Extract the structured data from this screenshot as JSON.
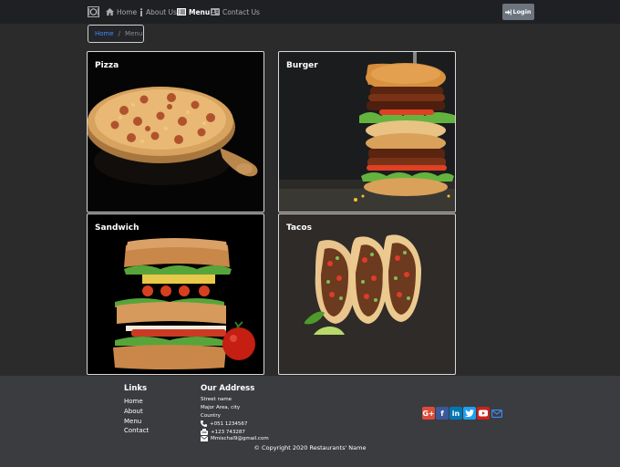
{
  "nav": {
    "home": "Home",
    "about": "About Us",
    "menu": "Menu",
    "contact": "Contact Us",
    "login": "Login",
    "brand_icon": "restaurant-plate-icon"
  },
  "breadcrumb": {
    "home": "Home",
    "separator": "/",
    "current": "Menu"
  },
  "cards": [
    {
      "title": "Pizza"
    },
    {
      "title": "Burger"
    },
    {
      "title": "Sandwich"
    },
    {
      "title": "Tacos"
    }
  ],
  "footer": {
    "links_heading": "Links",
    "links": [
      "Home",
      "About",
      "Menu",
      "Contact"
    ],
    "address_heading": "Our Address",
    "street": "Street name",
    "area": "Major Area, city",
    "country": "Country",
    "phone": "+051 1234567",
    "fax": "+123 743287",
    "email": "Mmischal9@gmail.com",
    "social": [
      "google-plus",
      "facebook",
      "linkedin",
      "twitter",
      "youtube",
      "email"
    ],
    "copyright": "© Copyright 2020 Restaurants' Name"
  },
  "colors": {
    "accent": "#3f8cff",
    "navbar": "#1f2023",
    "body": "#2b2b2b",
    "footer": "#3b3c3f"
  }
}
